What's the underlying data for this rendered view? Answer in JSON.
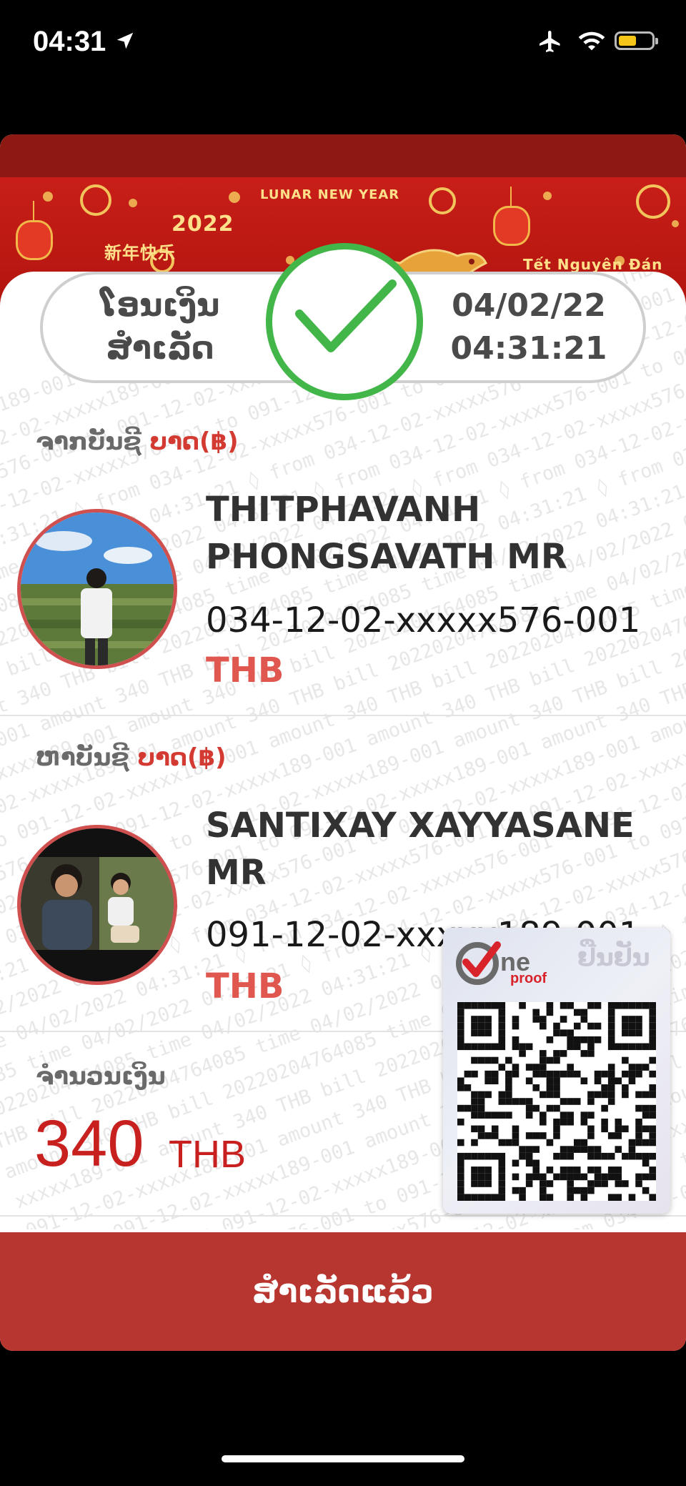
{
  "status_bar": {
    "time": "04:31"
  },
  "banner": {
    "year": "2022",
    "lunar_text": "LUNAR NEW YEAR",
    "chinese_text": "新年快乐",
    "tet_text": "Tết Nguyên Đán"
  },
  "transfer": {
    "status_line1": "ໂອນເງິນ",
    "status_line2": "ສຳເລັດ",
    "date": "04/02/22",
    "time": "04:31:21"
  },
  "from": {
    "label": "ຈາກບັນຊີ",
    "currency_label": "ບາດ(฿)",
    "name": "THITPHAVANH PHONGSAVATH MR",
    "account": "034-12-02-xxxxx576-001",
    "currency": "THB"
  },
  "to": {
    "label": "ຫາບັນຊີ",
    "currency_label": "ບາດ(฿)",
    "name": "SANTIXAY XAYYASANE MR",
    "account": "091-12-02-xxxxx189-001",
    "currency": "THB"
  },
  "amount": {
    "label": "ຈຳນວນເງິນ",
    "value": "340",
    "currency": "THB"
  },
  "verify": {
    "logo_text": "proof",
    "confirm_text": "ຢືນຢັນ"
  },
  "done_button": {
    "label": "ສຳເລັດແລ້ວ"
  },
  "watermark_lines": [
    "001 to 091-12-02-xxxxx189-001 amount 340 THB bill 20220204764085 time 04/02/2022 04:31:21",
    "xxxxx576-001 to 091-12-02-xxxxx189-001 amount 340 THB bill 20220204764085 time 04/02/2022",
    "from 034-12-02-xxxxx576-001 to 091-12-02-xxxxx189-001 amount 340 THB bill 20220204764085",
    "04:31:21 ◊ from 034-12-02-xxxxx576-001 to 091-12-02-xxxxx189-001 amount 340 THB bill 2022",
    "time 04/02/2022 04:31:21 ◊ from 034-12-02-xxxxx576-001 to 091-12-02-xxxxx189-001 amount 340",
    "20220204764085 time 04/02/2022 04:31:21 ◊ from 034-12-02-xxxxx576-001 to 091-12-02-xxxxx189",
    "bill 20220204764085 time 04/02/2022 04:31:21 ◊ from 034-12-02-xxxxx576-001 to 091-12-02-xx",
    "340 THB bill 20220204764085 time 04/02/2022 04:31:21 ◊ from 034-12-02-xxxxx576-001 to 091",
    "amount 340 THB bill 20220204764085 time 04/02/2022 04:31:21 ◊ from 034-12-02-xxxxx576-001",
    "189-001 amount 340 THB bill 20220204764085 time 04/02/2022 04:31:21 ◊ from 034-12-02-xxxxx",
    "02-xxxxx189-001 amount 340 THB bill 20220204764085 time 04/02/2022 04:31:21 ◊ from 034-12",
    "091-12-02-xxxxx189-001 amount 340 THB bill 20220204764085 time 04/02/2022 04:31:21 ◊ from",
    "to 091-12-02-xxxxx189-001 amount 340 THB bill 20220204764085 time 04/02/2022 04:31:21 ◊",
    "576-001 to 091-12-02-xxxxx189-001 amount 340 THB bill 20220204764085 time 04/02/2022 04:31",
    "02-xxxxx576-001 to 091-12-02-xxxxx189-001 amount 340 THB bill 20220204764085 time 04/02/20",
    "034-12-02-xxxxx576-001 to 091-12-02-xxxxx189-001 amount 340 THB bill 20220204764085 time",
    "◊ from 034-12-02-xxxxx576-001 to 091-12-02-xxxxx189-001 amount 340 THB bill 2022020476408",
    "04:31:21 ◊ from 034-12-02-xxxxx576-001 to 091-12-02-xxxxx189-001 amount 340 THB bill 20220",
    "04/02/2022 04:31:21 ◊ from 034-12-02-xxxxx576-001 to 091-12-02-xxxxx189-001 amount 340 TH",
    "time 04/02/2022 04:31:21 ◊ from 034-12-02-xxxxx576-001 to 091-12-02-xxxxx189-001 amount 3",
    "4085 time 04/02/2022 04:31:21 ◊ from 034-12-02-xxxxx576-001 to 091-12-02-xxxxx189-001 amo",
    "20220204764085 time 04/02/2022 04:31:21 ◊ from 034-12-02-xxxxx576-001 to 091-12-02-xxxxx1",
    "THB bill 20220204764085 time 04/02/2022 04:31:21 ◊ from 034-12-02-xxxxx576-001 to 091-12-",
    "amount 340 THB bill 20220204764085 time 04/02/2022 04:31:21 ◊ from 034-12-02-xxxxx576-001",
    "xxxxx189-001 amount 340 THB bill 20220204764085 time 04/02/2022 04:31:21 ◊ from 034-12-02",
    "091-12-02-xxxxx189-001 amount 340 THB bill 20220204764085 time 04/02/2022 04:31:21 ◊ from",
    "001 to 091-12-02-xxxxx189-001 amount 340 THB bill 20220204764085 time 04/02/2022 04:31:21",
    "xxxxx576-001 to 091-12-02-xxxxx189-001 amount 340 THB bill 20220204764085 time 04/02/2022",
    "from 034-12-02-xxxxx576-001 to 091-12-02-xxxxx189-001 amount 340 THB bill 20220204764085",
    "04:31:21 ◊ from 034-12-02-xxxxx576-001 to 091-12-02-xxxxx189-001 amount 340 THB bill 2022",
    "time 04/02/2022 04:31:21 ◊ from 034-12-02-xxxxx576-001 to 091-12-02-xxxxx189-001 amount 340",
    "20220204764085 time 04/02/2022 04:31:21 ◊ from 034-12-02-xxxxx576-001 to 091-12-02-xxxxx189"
  ]
}
